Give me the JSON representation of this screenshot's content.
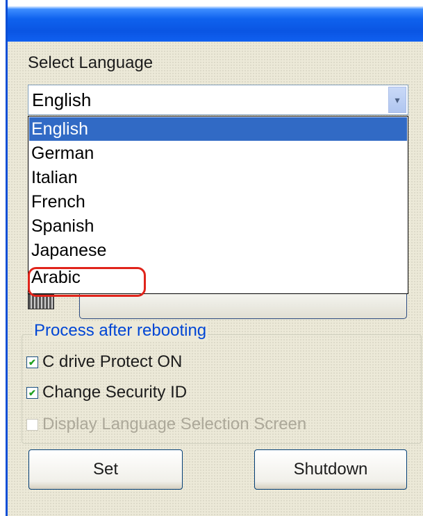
{
  "window": {
    "accent": "#0a55e3"
  },
  "language": {
    "label": "Select Language",
    "selected": "English",
    "options": [
      "English",
      "German",
      "Italian",
      "French",
      "Spanish",
      "Japanese",
      "Arabic"
    ],
    "highlighted_option": "Arabic",
    "highlight_color": "#e0241b"
  },
  "keyboard": {
    "icon": "keyboard-icon"
  },
  "process_group": {
    "title": "Process after rebooting",
    "options": [
      {
        "label": "C drive Protect ON",
        "checked": true,
        "enabled": true
      },
      {
        "label": "Change Security ID",
        "checked": true,
        "enabled": true
      },
      {
        "label": "Display Language Selection Screen",
        "checked": false,
        "enabled": false
      }
    ]
  },
  "buttons": {
    "set": "Set",
    "shutdown": "Shutdown"
  }
}
